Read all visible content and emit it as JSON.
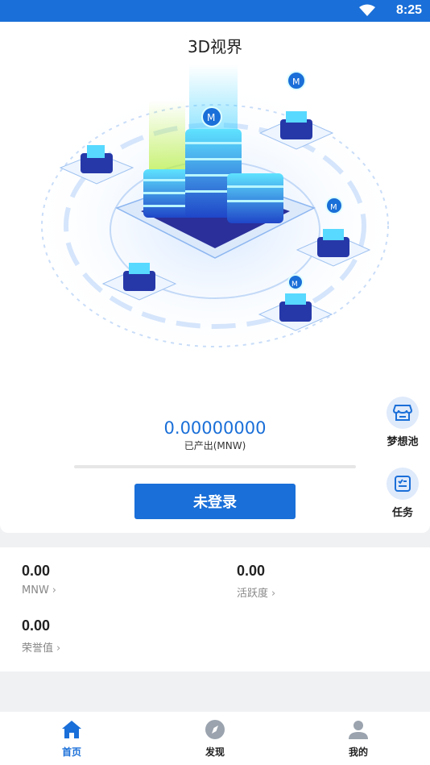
{
  "status_bar": {
    "time": "8:25"
  },
  "header": {
    "title": "3D视界"
  },
  "mining": {
    "amount": "0.00000000",
    "amount_label": "已产出(MNW)",
    "progress": 0,
    "login_button": "未登录"
  },
  "side_actions": [
    {
      "label": "梦想池",
      "icon": "store-icon"
    },
    {
      "label": "任务",
      "icon": "task-list-icon"
    }
  ],
  "stats": [
    {
      "value": "0.00",
      "label": "MNW"
    },
    {
      "value": "0.00",
      "label": "活跃度"
    },
    {
      "value": "0.00",
      "label": "荣誉值"
    }
  ],
  "tabbar": {
    "items": [
      {
        "label": "首页",
        "icon": "home-icon",
        "active": true
      },
      {
        "label": "发现",
        "icon": "compass-icon",
        "active": false
      },
      {
        "label": "我的",
        "icon": "person-icon",
        "active": false
      }
    ]
  },
  "colors": {
    "primary": "#1a6fd8",
    "inactive": "#9aa3ae",
    "background": "#f0f1f3"
  }
}
